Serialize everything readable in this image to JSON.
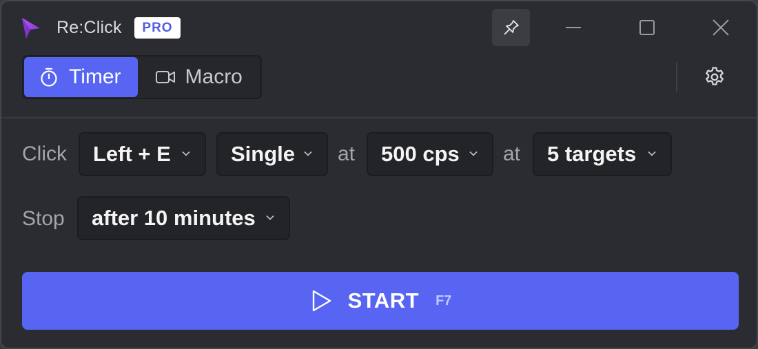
{
  "app": {
    "title": "Re:Click",
    "badge": "PRO",
    "accent_color": "#5865f2",
    "logo_color": "#9d4edd"
  },
  "titlebar": {
    "icons": [
      "pin-icon",
      "minimize-icon",
      "maximize-icon",
      "close-icon"
    ]
  },
  "modes": {
    "tabs": [
      {
        "label": "Timer",
        "icon": "stopwatch-icon",
        "active": true
      },
      {
        "label": "Macro",
        "icon": "video-camera-icon",
        "active": false
      }
    ]
  },
  "settings": {
    "icon": "gear-icon"
  },
  "click_row": {
    "label": "Click",
    "button": "Left + E",
    "type": "Single",
    "connector_1": "at",
    "rate": "500 cps",
    "connector_2": "at",
    "targets": "5 targets"
  },
  "stop_row": {
    "label": "Stop",
    "condition": "after 10 minutes"
  },
  "start": {
    "label": "START",
    "hotkey": "F7",
    "icon": "play-icon"
  }
}
